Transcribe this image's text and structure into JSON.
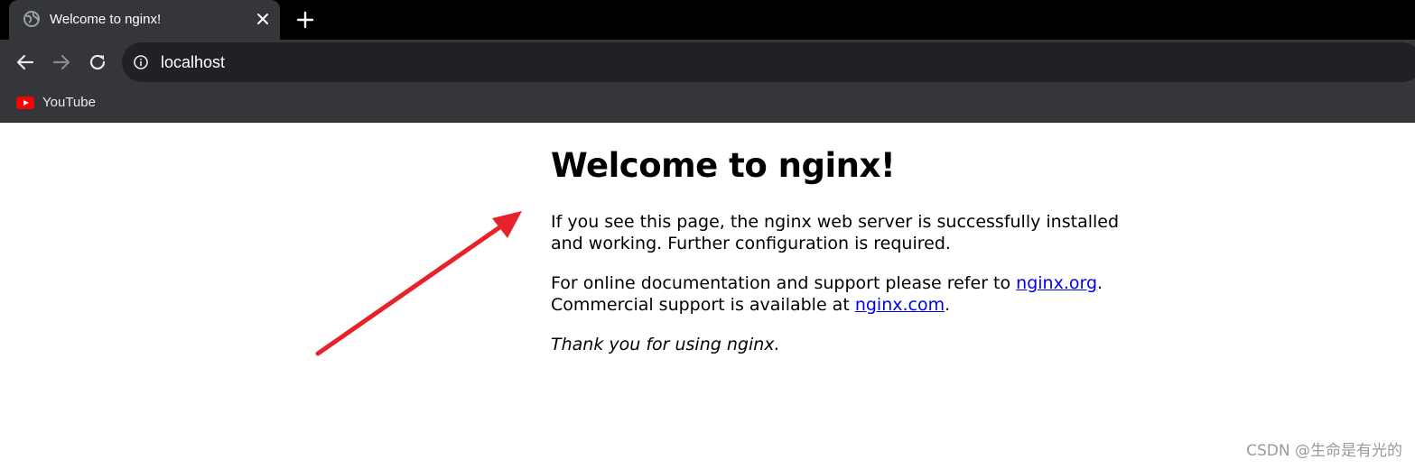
{
  "browser": {
    "tab": {
      "title": "Welcome to nginx!",
      "favicon": "globe-icon",
      "close_icon": "close-icon"
    },
    "new_tab_icon": "plus-icon",
    "toolbar": {
      "back_icon": "arrow-left-icon",
      "forward_icon": "arrow-right-icon",
      "reload_icon": "reload-icon",
      "site_info_icon": "info-icon",
      "url": "localhost"
    },
    "bookmarks": [
      {
        "label": "YouTube",
        "icon": "youtube-icon"
      }
    ],
    "colors": {
      "tabstrip": "#000000",
      "active_tab": "#35363a",
      "toolbar": "#35363a",
      "omnibox": "#202124",
      "youtube_red": "#ff0000"
    }
  },
  "page": {
    "heading": "Welcome to nginx!",
    "paragraph1": "If you see this page, the nginx web server is successfully installed and working. Further configuration is required.",
    "paragraph2": {
      "text_before_link1": "For online documentation and support please refer to ",
      "link1": "nginx.org",
      "text_after_link1": ".",
      "text_before_link2": "Commercial support is available at ",
      "link2": "nginx.com",
      "text_after_link2": "."
    },
    "paragraph3": "Thank you for using nginx.",
    "link_color": "#0000ee"
  },
  "annotation": {
    "arrow_color": "#e8222b"
  },
  "watermark": "CSDN @生命是有光的"
}
